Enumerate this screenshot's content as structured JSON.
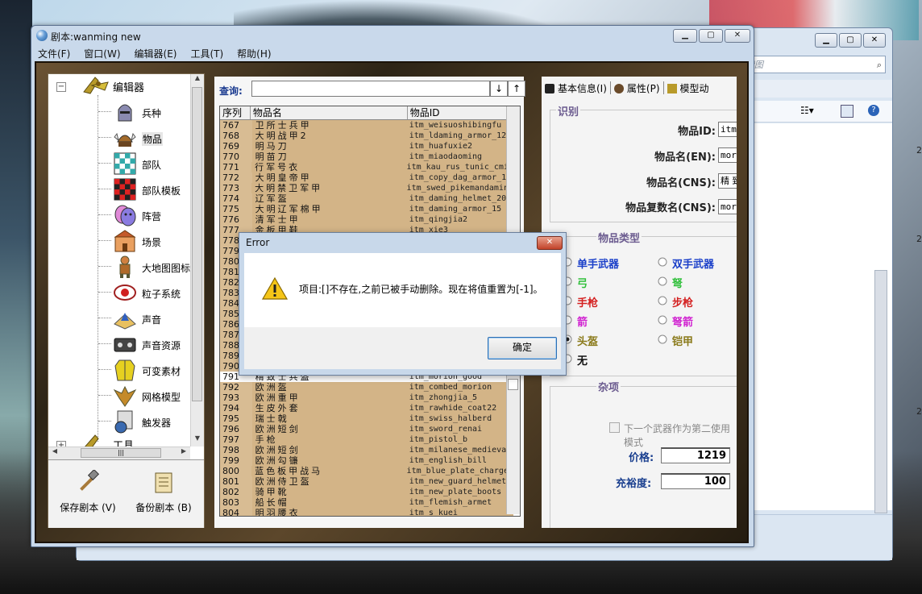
{
  "background_window": {
    "search_placeholder": "搜索图",
    "side_digits": [
      "2",
      "2",
      "2"
    ]
  },
  "window": {
    "title": "剧本:wanming new",
    "buttons": [
      "minimize",
      "maximize",
      "close"
    ],
    "menu": [
      "文件(F)",
      "窗口(W)",
      "编辑器(E)",
      "工具(T)",
      "帮助(H)"
    ]
  },
  "tree": {
    "root_label": "编辑器",
    "nodes": [
      {
        "label": "兵种",
        "icon": "knight-helmet-icon"
      },
      {
        "label": "物品",
        "icon": "viking-helmet-icon"
      },
      {
        "label": "部队",
        "icon": "chessboard-icon"
      },
      {
        "label": "部队模板",
        "icon": "red-chessboard-icon"
      },
      {
        "label": "阵营",
        "icon": "masks-icon"
      },
      {
        "label": "场景",
        "icon": "castle-icon"
      },
      {
        "label": "大地图图标",
        "icon": "map-figure-icon"
      },
      {
        "label": "粒子系统",
        "icon": "particle-icon"
      },
      {
        "label": "声音",
        "icon": "sound-icon"
      },
      {
        "label": "声音资源",
        "icon": "cassette-icon"
      },
      {
        "label": "可变素材",
        "icon": "vest-icon"
      },
      {
        "label": "网格模型",
        "icon": "eagle-icon"
      },
      {
        "label": "触发器",
        "icon": "trigger-icon"
      }
    ],
    "selected": "物品",
    "next_root": "工具"
  },
  "left_buttons": [
    {
      "label": "保存剧本 (V)",
      "icon": "hammer-icon"
    },
    {
      "label": "备份剧本 (B)",
      "icon": "scroll-icon"
    }
  ],
  "query": {
    "label": "查询:",
    "value": "",
    "sort_down": "↓",
    "sort_up": "↑"
  },
  "grid": {
    "headers": [
      "序列",
      "物品名",
      "物品ID"
    ],
    "rows": [
      [
        "767",
        "卫所士兵甲",
        "itm_weisuoshibingfu"
      ],
      [
        "768",
        "大明战甲2",
        "itm_ldaming_armor_121"
      ],
      [
        "769",
        "明马刀",
        "itm_huafuxie2"
      ],
      [
        "770",
        "明苗刀",
        "itm_miaodaoming"
      ],
      [
        "771",
        "行军号衣",
        "itm_kau_rus_tunic_cmir"
      ],
      [
        "772",
        "大明皇帝甲",
        "itm_copy_dag_armor_19"
      ],
      [
        "773",
        "大明禁卫军甲",
        "itm_swed_pikemandamina"
      ],
      [
        "774",
        "辽军盔",
        "itm_daming_helmet_20"
      ],
      [
        "775",
        "大明辽军棉甲",
        "itm_daming_armor_15"
      ],
      [
        "776",
        "清军士甲",
        "itm_qingjia2"
      ],
      [
        "777",
        "金板甲鞋",
        "itm_xie3"
      ],
      [
        "778",
        "",
        ""
      ],
      [
        "779",
        "",
        ""
      ],
      [
        "780",
        "",
        ""
      ],
      [
        "781",
        "",
        ""
      ],
      [
        "782",
        "",
        ""
      ],
      [
        "783",
        "",
        ""
      ],
      [
        "784",
        "",
        ""
      ],
      [
        "785",
        "",
        ""
      ],
      [
        "786",
        "",
        ""
      ],
      [
        "787",
        "",
        ""
      ],
      [
        "788",
        "",
        ""
      ],
      [
        "789",
        "",
        ""
      ],
      [
        "790",
        "",
        ""
      ],
      [
        "791",
        "精致士兵盔",
        "itm_morion_good"
      ],
      [
        "792",
        "欧洲盔",
        "itm_combed_morion"
      ],
      [
        "793",
        "欧洲重甲",
        "itm_zhongjia_5"
      ],
      [
        "794",
        "生皮外套",
        "itm_rawhide_coat22"
      ],
      [
        "795",
        "瑞士戟",
        "itm_swiss_halberd"
      ],
      [
        "796",
        "欧洲短剑",
        "itm_sword_renai"
      ],
      [
        "797",
        "手枪",
        "itm_pistol_b"
      ],
      [
        "798",
        "欧洲短剑",
        "itm_milanese_medieval"
      ],
      [
        "799",
        "欧洲勾镰",
        "itm_english_bill"
      ],
      [
        "800",
        "蓝色板甲战马",
        "itm_blue_plate_charger"
      ],
      [
        "801",
        "欧洲侍卫盔",
        "itm_new_guard_helmet"
      ],
      [
        "802",
        "骑甲靴",
        "itm_new_plate_boots"
      ],
      [
        "803",
        "船长帽",
        "itm_flemish_armet"
      ],
      [
        "804",
        "明羽腰衣",
        "itm_s_kuei"
      ]
    ],
    "selected_row": "791"
  },
  "tabs": [
    {
      "label": "基本信息(I)",
      "icon": "tab-info-icon"
    },
    {
      "label": "属性(P)",
      "icon": "tab-props-icon"
    },
    {
      "label": "模型动",
      "icon": "tab-model-icon"
    }
  ],
  "identity": {
    "title": "识别",
    "fields": [
      {
        "label": "物品ID:",
        "value": "itm_morion_"
      },
      {
        "label": "物品名(EN):",
        "value": "morion_goo"
      },
      {
        "label": "物品名(CNS):",
        "value": "精 致 士 兵"
      },
      {
        "label": "物品复数名(CNS):",
        "value": "morion_goo"
      }
    ]
  },
  "item_type": {
    "title": "物品类型",
    "options": [
      {
        "label": "单手武器",
        "color": "#1a3fc9",
        "checked": false
      },
      {
        "label": "双手武器",
        "color": "#1a3fc9",
        "checked": false
      },
      {
        "label": "弓",
        "color": "#2fbf3a",
        "checked": false
      },
      {
        "label": "弩",
        "color": "#2fbf3a",
        "checked": false
      },
      {
        "label": "手枪",
        "color": "#d42020",
        "checked": false
      },
      {
        "label": "步枪",
        "color": "#d42020",
        "checked": false
      },
      {
        "label": "箭",
        "color": "#d020d0",
        "checked": false
      },
      {
        "label": "弩箭",
        "color": "#d020d0",
        "checked": false
      },
      {
        "label": "头盔",
        "color": "#8a7a1a",
        "checked": true
      },
      {
        "label": "铠甲",
        "color": "#8a7a1a",
        "checked": false
      },
      {
        "label": "无",
        "color": "#111111",
        "checked": false
      }
    ]
  },
  "misc": {
    "title": "杂项",
    "checkbox_label": "下一个武器作为第二使用模式",
    "price_label": "价格:",
    "price_value": "1219",
    "abundance_label": "充裕度:",
    "abundance_value": "100"
  },
  "dialog": {
    "title": "Error",
    "message": "项目:[]不存在,之前已被手动删除。现在将值重置为[-1]。",
    "ok_label": "确定"
  }
}
